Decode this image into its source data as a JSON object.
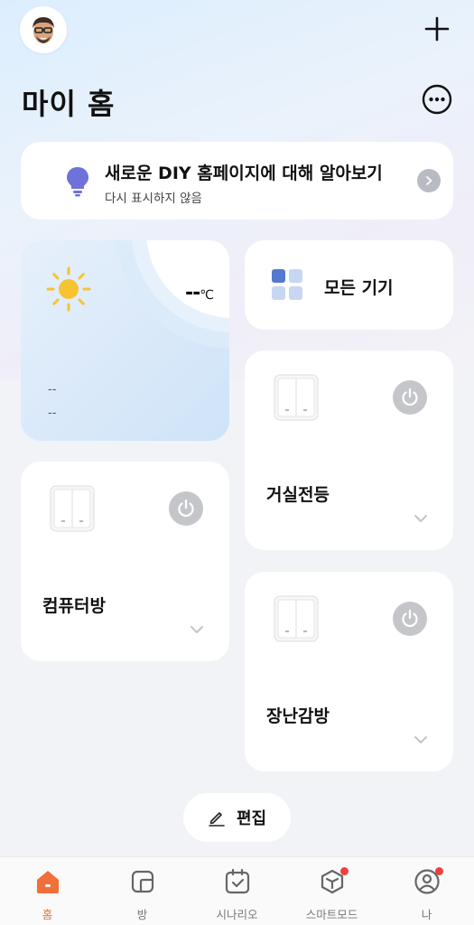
{
  "header": {
    "title": "마이 홈"
  },
  "banner": {
    "title": "새로운 DIY 홈페이지에 대해 알아보기",
    "subtitle": "다시 표시하지 않음"
  },
  "weather": {
    "temperature": "--",
    "unit": "℃",
    "line1": "--",
    "line2": "--"
  },
  "all_devices": {
    "label": "모든 기기"
  },
  "devices": [
    {
      "name": "거실전등",
      "power": "off"
    },
    {
      "name": "컴퓨터방",
      "power": "off"
    },
    {
      "name": "장난감방",
      "power": "off"
    }
  ],
  "edit": {
    "label": "편집"
  },
  "nav": {
    "items": [
      {
        "label": "홈",
        "icon": "home-icon",
        "active": true,
        "badge": false
      },
      {
        "label": "방",
        "icon": "room-icon",
        "active": false,
        "badge": false
      },
      {
        "label": "시나리오",
        "icon": "scenario-icon",
        "active": false,
        "badge": false
      },
      {
        "label": "스마트모드",
        "icon": "smart-mode-icon",
        "active": false,
        "badge": true
      },
      {
        "label": "나",
        "icon": "profile-icon",
        "active": false,
        "badge": true
      }
    ]
  },
  "colors": {
    "accent": "#f0703a",
    "badge": "#ee4040",
    "power_off": "#c5c6ca",
    "bulb": "#6f72d9",
    "sun": "#f7c331"
  }
}
